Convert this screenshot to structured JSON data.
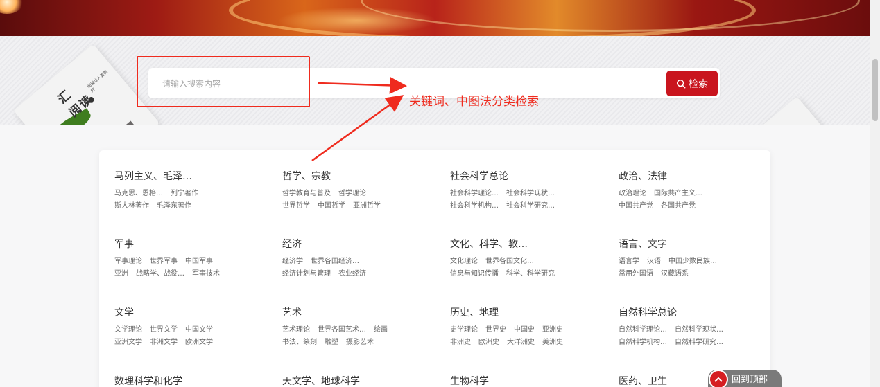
{
  "search": {
    "placeholder": "请输入搜索内容",
    "button_label": "检索"
  },
  "book": {
    "title_line1": "汇",
    "title_line2": "阅读",
    "subtitle": "阅读让人更美好"
  },
  "annotation": {
    "text": "关键词、中图法分类检索",
    "color": "#ef2b1e"
  },
  "categories": [
    {
      "title": "马列主义、毛泽…",
      "row1": [
        "马克思、恩格…",
        "列宁著作"
      ],
      "row2": [
        "斯大林著作",
        "毛泽东著作"
      ]
    },
    {
      "title": "哲学、宗教",
      "row1": [
        "哲学教育与普及",
        "哲学理论"
      ],
      "row2": [
        "世界哲学",
        "中国哲学",
        "亚洲哲学"
      ]
    },
    {
      "title": "社会科学总论",
      "row1": [
        "社会科学理论…",
        "社会科学现状…"
      ],
      "row2": [
        "社会科学机构…",
        "社会科学研究…"
      ]
    },
    {
      "title": "政治、法律",
      "row1": [
        "政治理论",
        "国际共产主义…"
      ],
      "row2": [
        "中国共产党",
        "各国共产党"
      ]
    },
    {
      "title": "军事",
      "row1": [
        "军事理论",
        "世界军事",
        "中国军事"
      ],
      "row2": [
        "亚洲",
        "战略学、战役…",
        "军事技术"
      ]
    },
    {
      "title": "经济",
      "row1": [
        "经济学",
        "世界各国经济…"
      ],
      "row2": [
        "经济计划与管理",
        "农业经济"
      ]
    },
    {
      "title": "文化、科学、教…",
      "row1": [
        "文化理论",
        "世界各国文化…"
      ],
      "row2": [
        "信息与知识传播",
        "科学、科学研究"
      ]
    },
    {
      "title": "语言、文字",
      "row1": [
        "语言学",
        "汉语",
        "中国少数民族…"
      ],
      "row2": [
        "常用外国语",
        "汉藏语系"
      ]
    },
    {
      "title": "文学",
      "row1": [
        "文学理论",
        "世界文学",
        "中国文学"
      ],
      "row2": [
        "亚洲文学",
        "非洲文学",
        "欧洲文学"
      ]
    },
    {
      "title": "艺术",
      "row1": [
        "艺术理论",
        "世界各国艺术…",
        "绘画"
      ],
      "row2": [
        "书法、篆刻",
        "雕塑",
        "摄影艺术"
      ]
    },
    {
      "title": "历史、地理",
      "row1": [
        "史学理论",
        "世界史",
        "中国史",
        "亚洲史"
      ],
      "row2": [
        "非洲史",
        "欧洲史",
        "大洋洲史",
        "美洲史"
      ]
    },
    {
      "title": "自然科学总论",
      "row1": [
        "自然科学理论…",
        "自然科学现状…"
      ],
      "row2": [
        "自然科学机构…",
        "自然科学研究…"
      ]
    },
    {
      "title": "数理科学和化学",
      "row1": [],
      "row2": []
    },
    {
      "title": "天文学、地球科学",
      "row1": [],
      "row2": []
    },
    {
      "title": "生物科学",
      "row1": [],
      "row2": []
    },
    {
      "title": "医药、卫生",
      "row1": [],
      "row2": []
    }
  ],
  "back_to_top": {
    "label": "回到顶部"
  },
  "colors": {
    "brand_red": "#c9151e",
    "back_top_bg": "#7a7a7a"
  }
}
